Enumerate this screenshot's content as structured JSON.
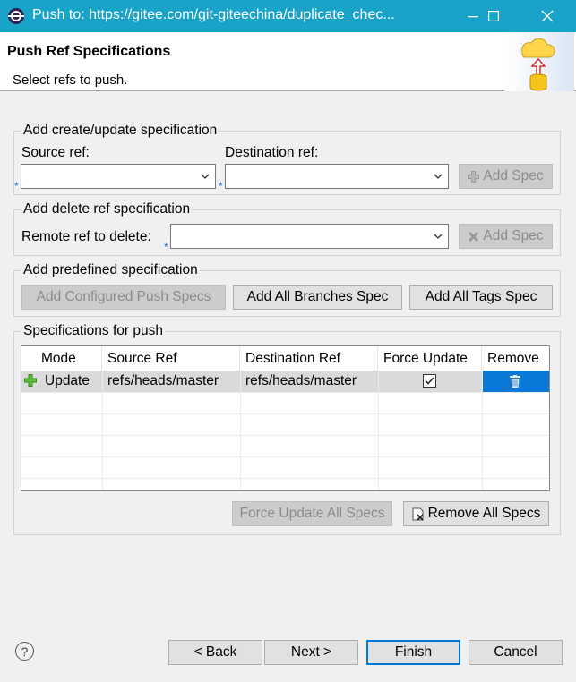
{
  "window": {
    "title": "Push to: https://gitee.com/git-giteechina/duplicate_chec...",
    "title_color": "#1aa3c9"
  },
  "header": {
    "title": "Push Ref Specifications",
    "description": "Select refs to push."
  },
  "create_update": {
    "group_label": "Add create/update specification",
    "source_label": "Source ref:",
    "source_value": "",
    "destination_label": "Destination ref:",
    "destination_value": "",
    "add_spec_label": "Add Spec"
  },
  "delete_ref": {
    "group_label": "Add delete ref specification",
    "remote_label": "Remote ref to delete:",
    "remote_value": "",
    "add_spec_label": "Add Spec"
  },
  "predefined": {
    "group_label": "Add predefined specification",
    "configured_label": "Add Configured Push Specs",
    "all_branches_label": "Add All Branches Spec",
    "all_tags_label": "Add All Tags Spec"
  },
  "specs": {
    "group_label": "Specifications for push",
    "columns": [
      "Mode",
      "Source Ref",
      "Destination Ref",
      "Force Update",
      "Remove"
    ],
    "rows": [
      {
        "mode": "Update",
        "source": "refs/heads/master",
        "destination": "refs/heads/master",
        "force_update": true
      }
    ],
    "force_update_all_label": "Force Update All Specs",
    "remove_all_label": "Remove All Specs",
    "remove_color": "#0a78d7"
  },
  "footer": {
    "help_label": "?",
    "back_label": "< Back",
    "next_label": "Next >",
    "finish_label": "Finish",
    "cancel_label": "Cancel"
  }
}
